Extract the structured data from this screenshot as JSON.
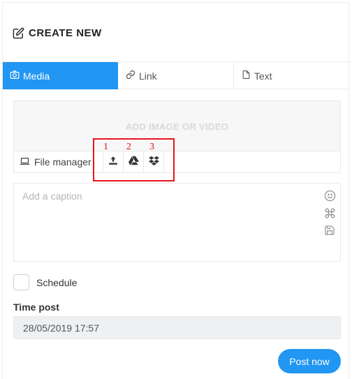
{
  "header": {
    "title": "CREATE NEW",
    "icon": "edit-icon"
  },
  "tabs": [
    {
      "label": "Media",
      "icon": "camera-icon",
      "active": true
    },
    {
      "label": "Link",
      "icon": "link-icon",
      "active": false
    },
    {
      "label": "Text",
      "icon": "file-icon",
      "active": false
    }
  ],
  "media": {
    "drop_label": "ADD IMAGE OR VIDEO",
    "file_manager_label": "File manager",
    "tools": [
      {
        "name": "upload",
        "icon": "upload-icon"
      },
      {
        "name": "google-drive",
        "icon": "google-drive-icon"
      },
      {
        "name": "dropbox",
        "icon": "dropbox-icon"
      }
    ]
  },
  "annotations": {
    "labels": [
      "1",
      "2",
      "3"
    ],
    "color": "#e8141b"
  },
  "caption": {
    "placeholder": "Add a caption",
    "icons": [
      "smile-icon",
      "command-icon",
      "save-icon"
    ]
  },
  "schedule": {
    "label": "Schedule",
    "checked": false
  },
  "time_post": {
    "label": "Time post",
    "value": "28/05/2019 17:57"
  },
  "actions": {
    "post_label": "Post now"
  },
  "colors": {
    "accent": "#2196f3"
  }
}
